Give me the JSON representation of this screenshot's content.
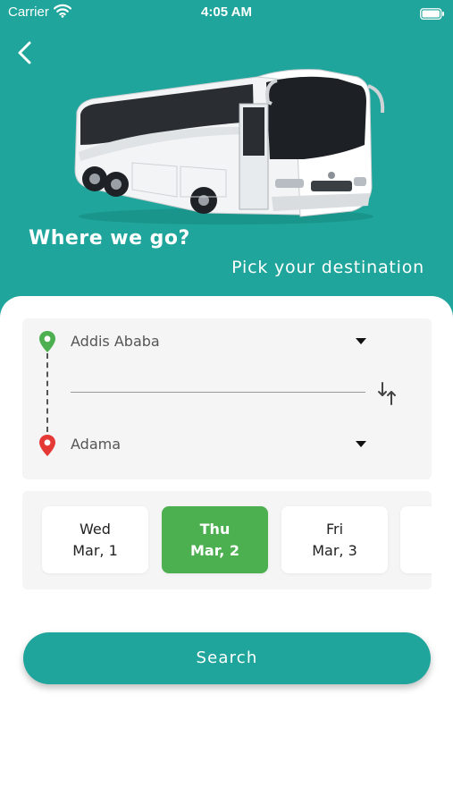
{
  "status_bar": {
    "carrier": "Carrier",
    "time": "4:05 AM",
    "wifi_icon": "wifi-icon",
    "battery_icon": "battery-icon"
  },
  "header": {
    "background_color": "#1fa59b",
    "back_icon": "chevron-left-icon",
    "image": "bus-image",
    "title": "Where we go?",
    "subtitle": "Pick your destination"
  },
  "route": {
    "from": {
      "icon": "location-pin-green-icon",
      "city": "Addis Ababa",
      "pin_color": "#4caf50"
    },
    "to": {
      "icon": "location-pin-red-icon",
      "city": "Adama",
      "pin_color": "#e53935"
    },
    "swap_icon": "swap-vertical-icon"
  },
  "dates": [
    {
      "day": "Wed",
      "date": "Mar, 1",
      "selected": false
    },
    {
      "day": "Thu",
      "date": "Mar, 2",
      "selected": true
    },
    {
      "day": "Fri",
      "date": "Mar, 3",
      "selected": false
    },
    {
      "day": "",
      "date": "",
      "selected": false
    }
  ],
  "selected_color": "#4caf50",
  "search": {
    "label": "Search"
  }
}
